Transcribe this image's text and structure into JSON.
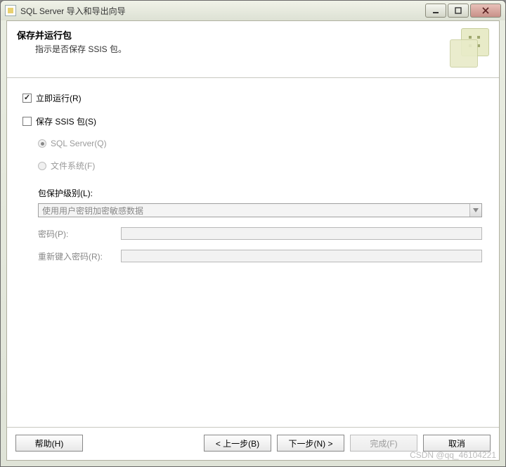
{
  "window": {
    "title": "SQL Server 导入和导出向导"
  },
  "header": {
    "title": "保存并运行包",
    "subtitle": "指示是否保存 SSIS 包。"
  },
  "options": {
    "run_immediately": "立即运行(R)",
    "save_ssis": "保存 SSIS 包(S)",
    "radio_sqlserver": "SQL Server(Q)",
    "radio_filesystem": "文件系统(F)"
  },
  "protection": {
    "label": "包保护级别(L):",
    "value": "使用用户密钥加密敏感数据"
  },
  "password": {
    "label": "密码(P):",
    "value": ""
  },
  "confirm_password": {
    "label": "重新键入密码(R):",
    "value": ""
  },
  "buttons": {
    "help": "帮助(H)",
    "back": "< 上一步(B)",
    "next": "下一步(N) >",
    "finish": "完成(F)",
    "cancel": "取消"
  },
  "watermark": "CSDN @qq_46104221"
}
